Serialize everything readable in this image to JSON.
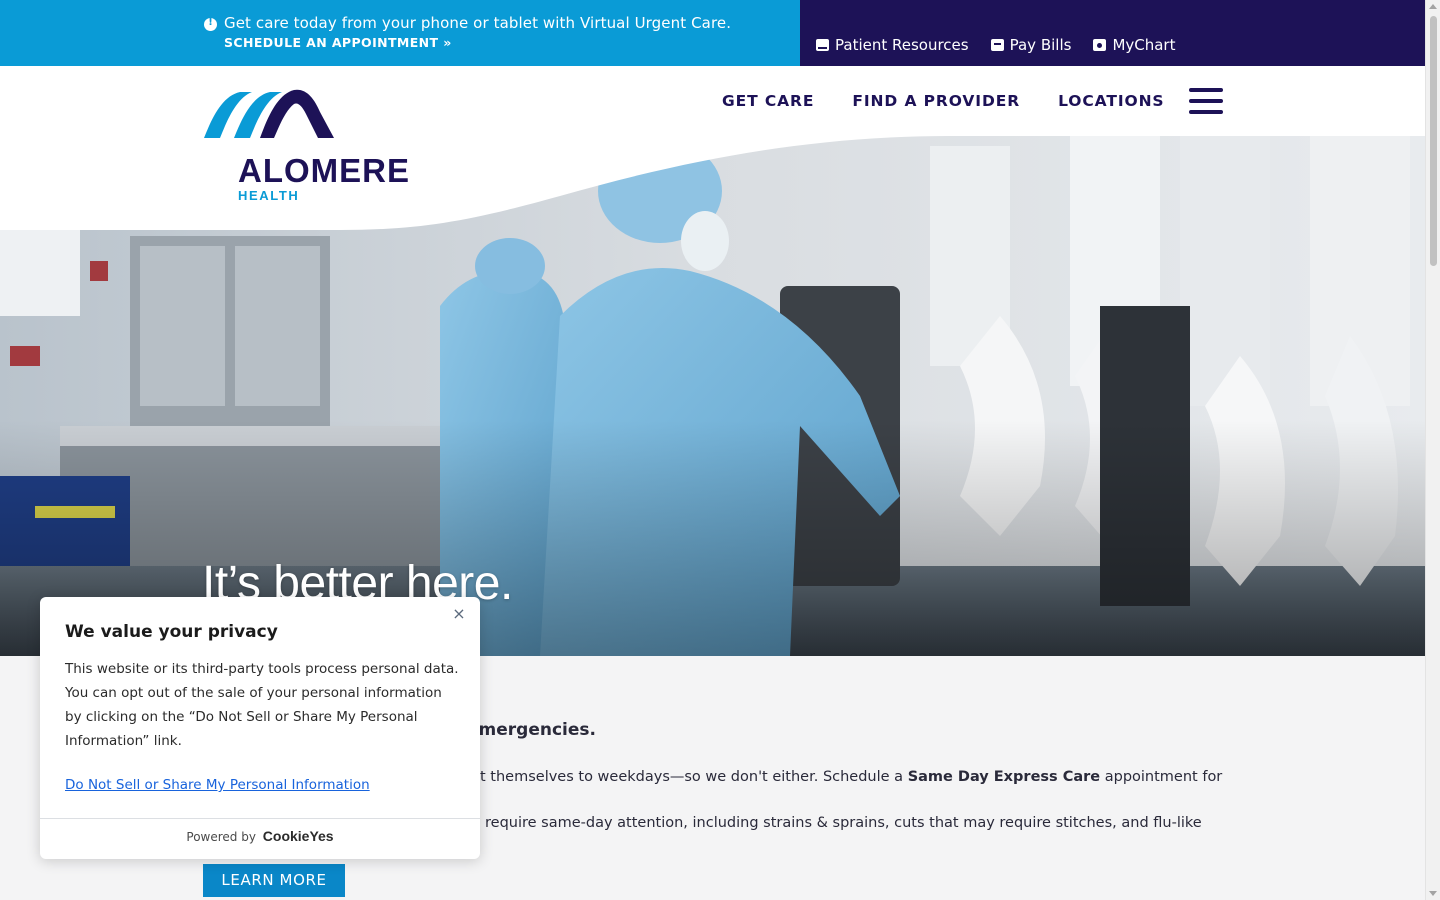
{
  "alert": {
    "text": "Get care today from your phone or tablet with Virtual Urgent Care.",
    "link": "SCHEDULE AN APPOINTMENT »"
  },
  "utility_nav": {
    "items": [
      {
        "label": "Patient Resources",
        "icon": "book-icon"
      },
      {
        "label": "Pay Bills",
        "icon": "bill-icon"
      },
      {
        "label": "MyChart",
        "icon": "mychart-icon"
      }
    ]
  },
  "logo": {
    "name": "ALOMERE",
    "sub": "HEALTH"
  },
  "main_nav": {
    "items": [
      {
        "label": "GET CARE"
      },
      {
        "label": "FIND A PROVIDER"
      },
      {
        "label": "LOCATIONS"
      }
    ]
  },
  "hero": {
    "headline": "It’s better here."
  },
  "content": {
    "heading_visible": "emergencies.",
    "text_part1": "t themselves to weekdays—so we don't either. Schedule a ",
    "text_bold": "Same Day Express Care",
    "text_part2": " appointment for non-",
    "text_line2": "require same-day attention, including strains & sprains, cuts that may require stitches, and flu-like",
    "button": "LEARN MORE"
  },
  "cookie_banner": {
    "title": "We value your privacy",
    "body": "This website or its third-party tools process personal data. You can opt out of the sale of your personal information by clicking on the “Do Not Sell or Share My Personal Information” link.",
    "link": "Do Not Sell or Share My Personal Information",
    "powered_by": "Powered by",
    "brand": "CookieYes"
  },
  "colors": {
    "alert_blue": "#0a9bd6",
    "navy": "#1d1257",
    "button_blue": "#0a87c8"
  }
}
